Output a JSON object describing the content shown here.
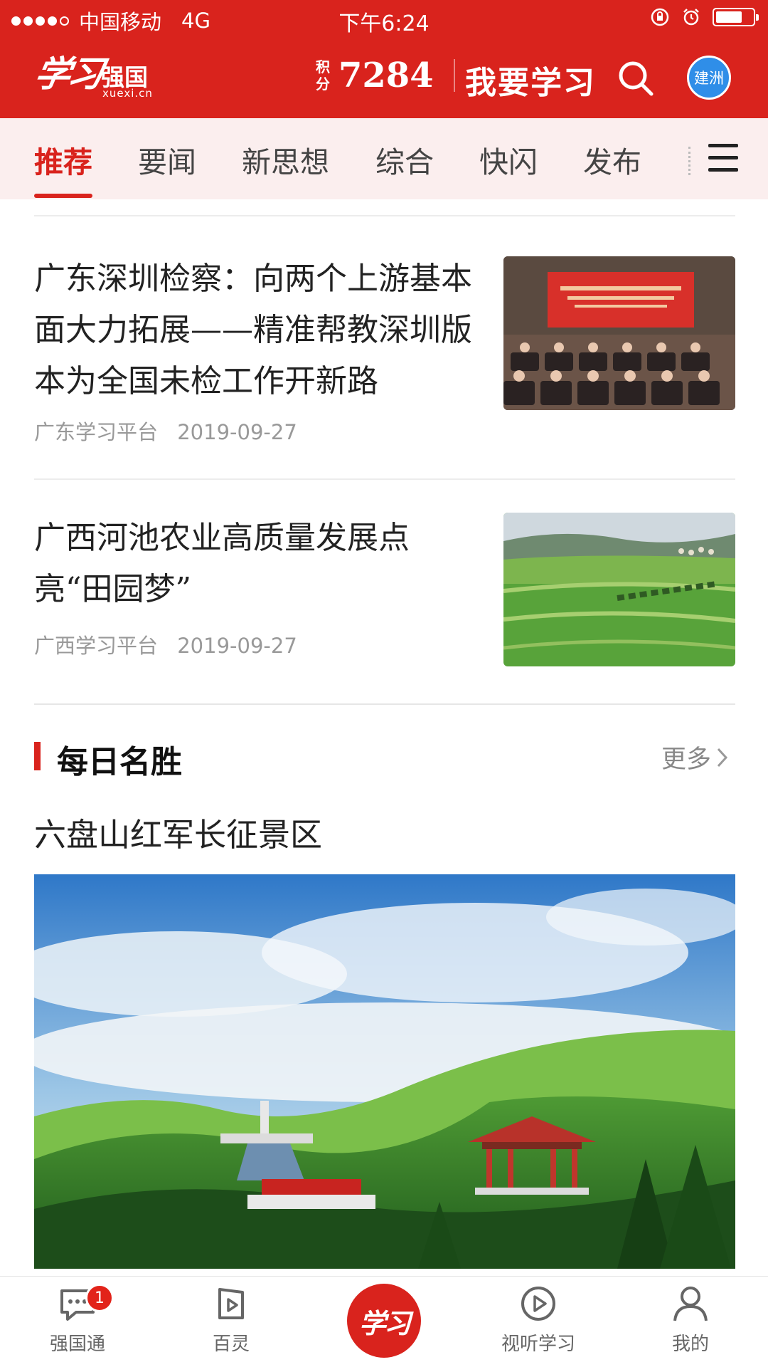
{
  "status_bar": {
    "carrier": "中国移动",
    "network": "4G",
    "time": "下午6:24"
  },
  "header": {
    "logo_script": "学习",
    "logo_text": "强国",
    "logo_domain": "xuexi.cn",
    "points_label_1": "积",
    "points_label_2": "分",
    "points_value": "7284",
    "study_button": "我要学习",
    "avatar_text": "建洲"
  },
  "tabs": [
    {
      "label": "推荐",
      "active": true
    },
    {
      "label": "要闻"
    },
    {
      "label": "新思想"
    },
    {
      "label": "综合"
    },
    {
      "label": "快闪"
    },
    {
      "label": "发布"
    }
  ],
  "articles": [
    {
      "title": "广东深圳检察：向两个上游基本面大力拓展——精准帮教深圳版本为全国未检工作开新路",
      "source": "广东学习平台",
      "date": "2019-09-27"
    },
    {
      "title": "广西河池农业高质量发展点亮“田园梦”",
      "source": "广西学习平台",
      "date": "2019-09-27"
    }
  ],
  "section": {
    "title": "每日名胜",
    "more": "更多",
    "item_title": "六盘山红军长征景区"
  },
  "bottom_nav": {
    "items": [
      {
        "label": "强国通",
        "icon": "chat-bubble-icon",
        "badge": "1"
      },
      {
        "label": "百灵",
        "icon": "play-card-icon"
      },
      {
        "label": "",
        "icon": "xuexi-center-icon",
        "center_text": "学习"
      },
      {
        "label": "视听学习",
        "icon": "play-circle-icon"
      },
      {
        "label": "我的",
        "icon": "person-icon"
      }
    ]
  },
  "colors": {
    "brand_red": "#d9231d",
    "tab_bg": "#fbeeee",
    "avatar_blue": "#2f8ee8"
  }
}
